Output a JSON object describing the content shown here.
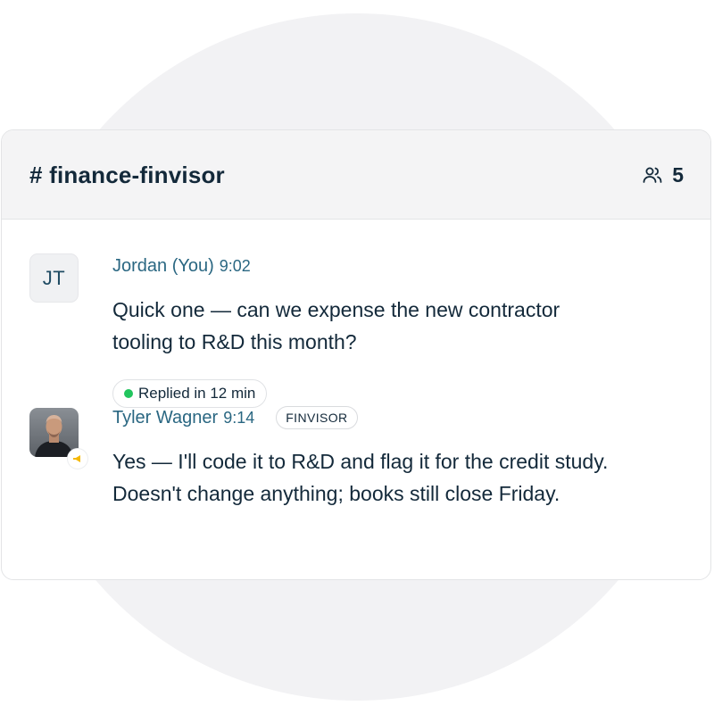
{
  "channel": {
    "name": "# finance-finvisor",
    "members_count": "5",
    "members_icon": "users-icon"
  },
  "messages": [
    {
      "avatar_initials": "JT",
      "author": "Jordan (You)",
      "time": "9:02",
      "lines": [
        "Quick one — can we expense the new contractor",
        "tooling to R&D this month?"
      ]
    },
    {
      "avatar": "tyler-wagner-photo",
      "presence_icon": "megaphone-icon",
      "author": "Tyler Wagner",
      "time": "9:14",
      "badge": "FINVISOR",
      "lines": [
        "Yes — I'll code it to R&D and flag it for the credit study.",
        "Doesn't change anything; books still close Friday."
      ],
      "reply_status": "Replied in 12 min"
    }
  ],
  "colors": {
    "text_primary": "#13293a",
    "author": "#2a6782",
    "status_green": "#22c55e",
    "header_bg": "#f4f4f5",
    "badge_accent": "#f5b800"
  }
}
